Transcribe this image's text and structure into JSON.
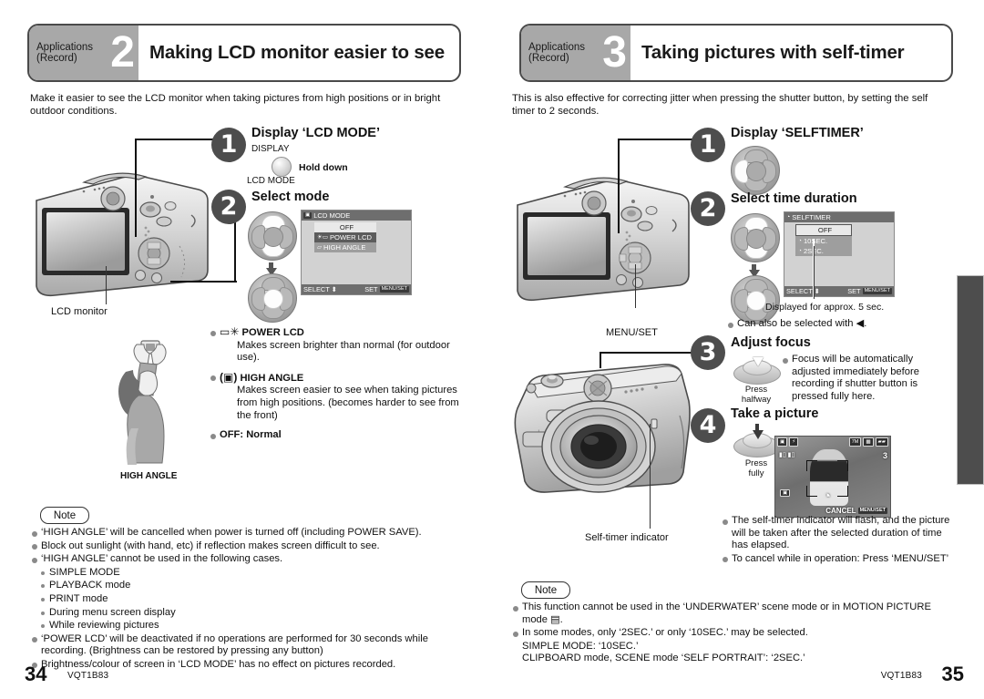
{
  "left_page": {
    "banner": {
      "category": "Applications",
      "category2": "(Record)",
      "number": "2",
      "title": "Making LCD monitor easier to see"
    },
    "intro": "Make it easier to see the LCD monitor when taking pictures from high positions or in bright outdoor conditions.",
    "camera_label": "LCD monitor",
    "high_angle_caption": "HIGH ANGLE",
    "steps": [
      {
        "number": "1",
        "title": "Display ‘LCD MODE’",
        "button_top_label": "DISPLAY",
        "button_bottom_label": "LCD MODE",
        "action": "Hold down"
      },
      {
        "number": "2",
        "title": "Select mode"
      }
    ],
    "lcd_menu": {
      "title": "LCD MODE",
      "rows": [
        {
          "label": "OFF",
          "state": "light"
        },
        {
          "label": "POWER LCD",
          "state": "dark"
        },
        {
          "label": "HIGH ANGLE",
          "state": "plain"
        }
      ],
      "footer_left": "SELECT",
      "footer_right": "SET",
      "footer_badge": "MENU/SET"
    },
    "mode_descriptions": [
      {
        "name": "POWER LCD",
        "icon": "power-lcd-icon",
        "text": "Makes screen brighter than normal (for outdoor use)."
      },
      {
        "name": "HIGH ANGLE",
        "icon": "high-angle-icon",
        "text": "Makes screen easier to see when taking pictures from high positions. (becomes harder to see from the front)"
      }
    ],
    "off_normal": "OFF: Normal",
    "note": {
      "label": "Note",
      "items": [
        {
          "level": 1,
          "text": "‘HIGH ANGLE’ will be cancelled when power is turned off (including POWER SAVE)."
        },
        {
          "level": 1,
          "text": "Block out sunlight (with hand, etc) if reflection makes screen difficult to see."
        },
        {
          "level": 1,
          "text": "‘HIGH ANGLE’ cannot be used in the following cases."
        },
        {
          "level": 2,
          "text": "SIMPLE MODE"
        },
        {
          "level": 2,
          "text": "PLAYBACK mode"
        },
        {
          "level": 2,
          "text": "PRINT mode"
        },
        {
          "level": 2,
          "text": "During menu screen display"
        },
        {
          "level": 2,
          "text": "While reviewing pictures"
        },
        {
          "level": 1,
          "text": "‘POWER LCD’ will be deactivated if no operations are performed for 30 seconds while recording. (Brightness can be restored by pressing any button)"
        },
        {
          "level": 1,
          "text": "Brightness/colour of screen in ‘LCD MODE’ has no effect on pictures recorded."
        }
      ]
    },
    "footer": {
      "page_number": "34",
      "code": "VQT1B83"
    }
  },
  "right_page": {
    "banner": {
      "category": "Applications",
      "category2": "(Record)",
      "number": "3",
      "title": "Taking pictures with self-timer"
    },
    "intro": "This is also effective for correcting jitter when pressing the shutter button, by setting the self timer to 2 seconds.",
    "camera_label_top": "MENU/SET",
    "camera_label_bottom": "Self-timer indicator",
    "steps": [
      {
        "number": "1",
        "title": "Display ‘SELFTIMER’"
      },
      {
        "number": "2",
        "title": "Select time duration"
      },
      {
        "number": "3",
        "title": "Adjust focus"
      },
      {
        "number": "4",
        "title": "Take a picture"
      }
    ],
    "selftimer_menu": {
      "title": "SELFTIMER",
      "rows": [
        {
          "label": "OFF",
          "state": "light"
        },
        {
          "label": "10SEC.",
          "state": "plain"
        },
        {
          "label": "2SEC.",
          "state": "plain"
        }
      ],
      "footer_left": "SELECT",
      "footer_right": "SET",
      "footer_badge": "MENU/SET"
    },
    "menu_caption": "Displayed for approx. 5 sec.",
    "menu_bullet": "Can also be selected with ◀.",
    "step3": {
      "press_label_line1": "Press",
      "press_label_line2": "halfway",
      "bullet": "Focus will be automatically adjusted immediately before recording if shutter button is pressed fully here."
    },
    "step4": {
      "press_label_line1": "Press",
      "press_label_line2": "fully",
      "preview_cancel": "CANCEL",
      "preview_badge": "MENU/SET",
      "preview_counter": "3",
      "preview_resolution": "7M"
    },
    "step4_bullets": [
      "The self-timer indicator will flash, and the picture will be taken after the selected duration of time has elapsed.",
      "To cancel while in operation: Press ‘MENU/SET’"
    ],
    "note": {
      "label": "Note",
      "items": [
        {
          "level": 1,
          "text": "This function cannot be used in the ‘UNDERWATER’ scene mode or in MOTION PICTURE mode ▤."
        },
        {
          "level": 1,
          "text": "In some modes, only ‘2SEC.’ or only ‘10SEC.’ may be selected."
        },
        {
          "level": 0,
          "text": "SIMPLE MODE: ‘10SEC.’"
        },
        {
          "level": 0,
          "text": "CLIPBOARD mode, SCENE mode ‘SELF PORTRAIT’: ‘2SEC.’"
        }
      ]
    },
    "footer": {
      "page_number": "35",
      "code": "VQT1B83"
    }
  },
  "colors": {
    "banner_tab": "#a8a8a8",
    "step_circle": "#4d4d4d",
    "bullet": "#8a8a8a",
    "edge_tab": "#4d4d4d"
  }
}
